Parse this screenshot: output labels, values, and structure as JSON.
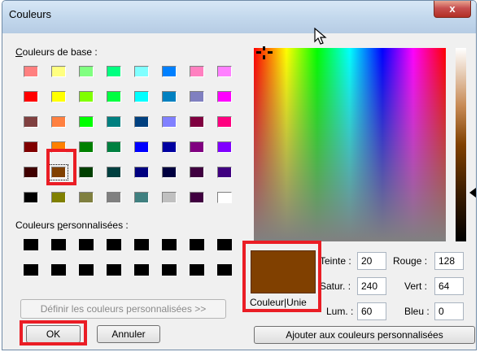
{
  "window": {
    "title": "Couleurs",
    "close_label": "x"
  },
  "basic_colors": {
    "label": "Couleurs de base :",
    "rows": [
      [
        "#ff8080",
        "#ffff80",
        "#80ff80",
        "#00ff80",
        "#80ffff",
        "#0080ff",
        "#ff80c0",
        "#ff80ff"
      ],
      [
        "#ff0000",
        "#ffff00",
        "#80ff00",
        "#00ff40",
        "#00ffff",
        "#0080c0",
        "#8080c0",
        "#ff00ff"
      ],
      [
        "#804040",
        "#ff8040",
        "#00ff00",
        "#008080",
        "#004080",
        "#8080ff",
        "#800040",
        "#ff0080"
      ],
      [
        "#800000",
        "#ff8000",
        "#008000",
        "#008040",
        "#0000ff",
        "#0000a0",
        "#800080",
        "#8000ff"
      ],
      [
        "#400000",
        "#804000",
        "#004000",
        "#004040",
        "#000080",
        "#000040",
        "#400040",
        "#400080"
      ],
      [
        "#000000",
        "#808000",
        "#808040",
        "#808080",
        "#408080",
        "#c0c0c0",
        "#400040",
        "#ffffff"
      ]
    ],
    "selected": "#804000"
  },
  "custom_colors": {
    "label": "Couleurs personnalisées :",
    "count": 16
  },
  "buttons": {
    "define_custom": "Définir les couleurs personnalisées >>",
    "ok": "OK",
    "cancel": "Annuler",
    "add_custom": "Ajouter aux couleurs personnalisées"
  },
  "preview": {
    "color": "#804000",
    "label": "Couleur|Unie"
  },
  "fields": {
    "hue_label": "Teinte :",
    "hue": "20",
    "sat_label": "Satur. :",
    "sat": "240",
    "lum_label": "Lum. :",
    "lum": "60",
    "red_label": "Rouge :",
    "red": "128",
    "green_label": "Vert :",
    "green": "64",
    "blue_label": "Bleu :",
    "blue": "0"
  },
  "annotations": {
    "highlight_color": "#ea1d25"
  }
}
